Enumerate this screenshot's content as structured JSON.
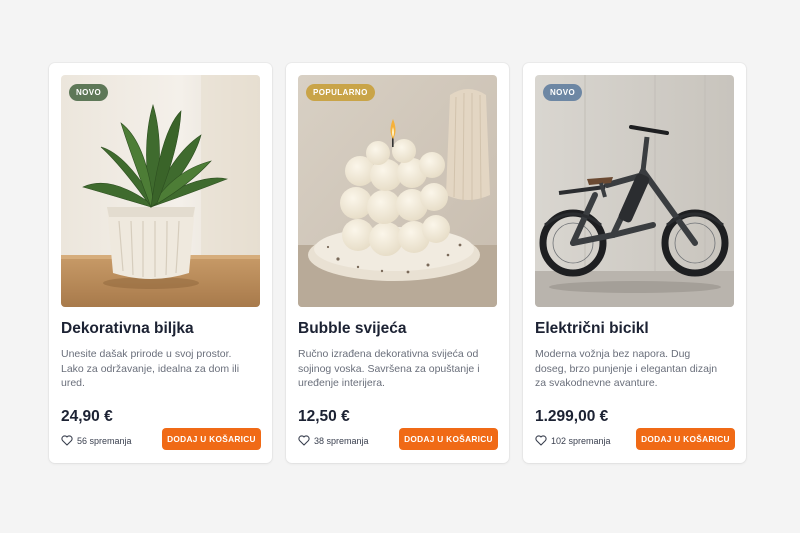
{
  "products": [
    {
      "badge": "NOVO",
      "badge_color": "#5e7858",
      "title": "Dekorativna biljka",
      "description": "Unesite dašak prirode u svoj prostor. Lako za održavanje, idealna za dom ili ured.",
      "price": "24,90 €",
      "likes": "56 spremanja",
      "button_label": "DODAJ U KOŠARICU",
      "image": "potted-plant-image"
    },
    {
      "badge": "POPULARNO",
      "badge_color": "#c9a448",
      "title": "Bubble svijeća",
      "description": "Ručno izrađena dekorativna svijeća od sojinog voska. Savršena za opuštanje i uređenje interijera.",
      "price": "12,50 €",
      "likes": "38 spremanja",
      "button_label": "DODAJ U KOŠARICU",
      "image": "bubble-candle-image"
    },
    {
      "badge": "NOVO",
      "badge_color": "#6d87a4",
      "title": "Električni bicikl",
      "description": "Moderna vožnja bez napora. Dug doseg, brzo punjenje i elegantan dizajn za svakodnevne avanture.",
      "price": "1.299,00 €",
      "likes": "102 spremanja",
      "button_label": "DODAJ U KOŠARICU",
      "image": "electric-bicycle-image"
    }
  ],
  "accent_color": "#f06a16"
}
